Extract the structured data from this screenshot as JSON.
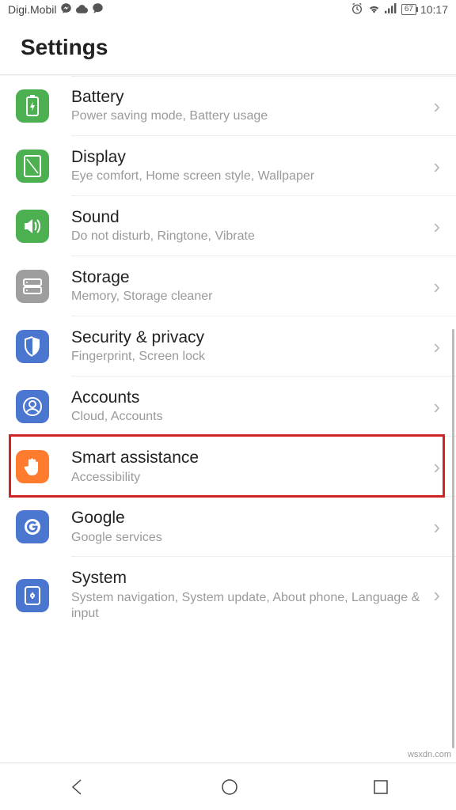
{
  "status": {
    "carrier": "Digi.Mobil",
    "battery": "67",
    "time": "10:17"
  },
  "header": {
    "title": "Settings"
  },
  "items": [
    {
      "title": "Battery",
      "subtitle": "Power saving mode, Battery usage"
    },
    {
      "title": "Display",
      "subtitle": "Eye comfort, Home screen style, Wallpaper"
    },
    {
      "title": "Sound",
      "subtitle": "Do not disturb, Ringtone, Vibrate"
    },
    {
      "title": "Storage",
      "subtitle": "Memory, Storage cleaner"
    },
    {
      "title": "Security & privacy",
      "subtitle": "Fingerprint, Screen lock"
    },
    {
      "title": "Accounts",
      "subtitle": "Cloud, Accounts"
    },
    {
      "title": "Smart assistance",
      "subtitle": "Accessibility"
    },
    {
      "title": "Google",
      "subtitle": "Google services"
    },
    {
      "title": "System",
      "subtitle": "System navigation, System update, About phone, Language & input"
    }
  ],
  "watermark": "wsxdn.com"
}
